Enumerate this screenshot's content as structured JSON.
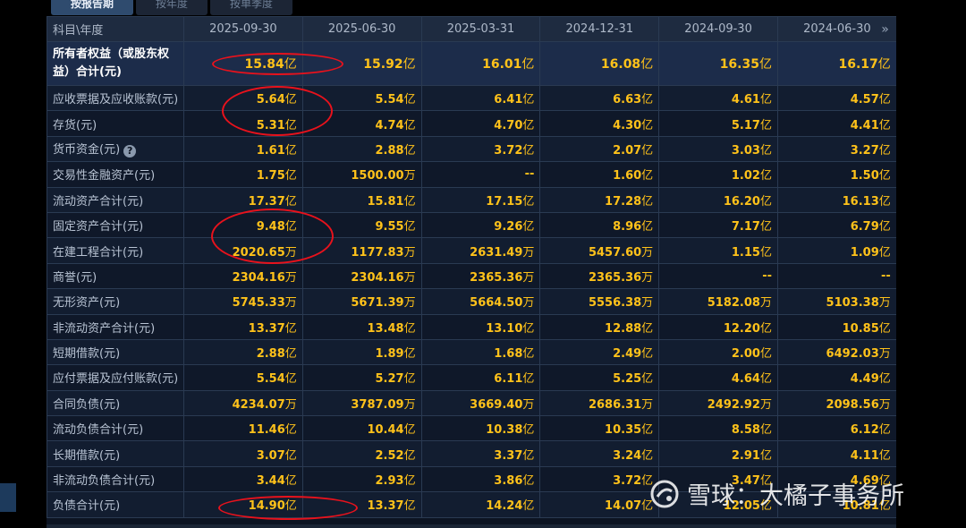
{
  "tabs": [
    "按报告期",
    "按年度",
    "按单季度"
  ],
  "header": {
    "first_col": "科目\\年度",
    "periods": [
      "2025-09-30",
      "2025-06-30",
      "2025-03-31",
      "2024-12-31",
      "2024-09-30",
      "2024-06-30"
    ],
    "more_icon": "double-chevron-right-icon"
  },
  "rows": [
    {
      "label": "所有者权益（或股东权益）合计(元)",
      "values": [
        [
          "15.84",
          "亿"
        ],
        [
          "15.92",
          "亿"
        ],
        [
          "16.01",
          "亿"
        ],
        [
          "16.08",
          "亿"
        ],
        [
          "16.35",
          "亿"
        ],
        [
          "16.17",
          "亿"
        ]
      ]
    },
    {
      "label": "应收票据及应收账款(元)",
      "values": [
        [
          "5.64",
          "亿"
        ],
        [
          "5.54",
          "亿"
        ],
        [
          "6.41",
          "亿"
        ],
        [
          "6.63",
          "亿"
        ],
        [
          "4.61",
          "亿"
        ],
        [
          "4.57",
          "亿"
        ]
      ]
    },
    {
      "label": "存货(元)",
      "values": [
        [
          "5.31",
          "亿"
        ],
        [
          "4.74",
          "亿"
        ],
        [
          "4.70",
          "亿"
        ],
        [
          "4.30",
          "亿"
        ],
        [
          "5.17",
          "亿"
        ],
        [
          "4.41",
          "亿"
        ]
      ]
    },
    {
      "label": "货币资金(元)",
      "values": [
        [
          "1.61",
          "亿"
        ],
        [
          "2.88",
          "亿"
        ],
        [
          "3.72",
          "亿"
        ],
        [
          "2.07",
          "亿"
        ],
        [
          "3.03",
          "亿"
        ],
        [
          "3.27",
          "亿"
        ]
      ]
    },
    {
      "label": "交易性金融资产(元)",
      "values": [
        [
          "1.75",
          "亿"
        ],
        [
          "1500.00",
          "万"
        ],
        [
          "--",
          ""
        ],
        [
          "1.60",
          "亿"
        ],
        [
          "1.02",
          "亿"
        ],
        [
          "1.50",
          "亿"
        ]
      ]
    },
    {
      "label": "流动资产合计(元)",
      "values": [
        [
          "17.37",
          "亿"
        ],
        [
          "15.81",
          "亿"
        ],
        [
          "17.15",
          "亿"
        ],
        [
          "17.28",
          "亿"
        ],
        [
          "16.20",
          "亿"
        ],
        [
          "16.13",
          "亿"
        ]
      ]
    },
    {
      "label": "固定资产合计(元)",
      "values": [
        [
          "9.48",
          "亿"
        ],
        [
          "9.55",
          "亿"
        ],
        [
          "9.26",
          "亿"
        ],
        [
          "8.96",
          "亿"
        ],
        [
          "7.17",
          "亿"
        ],
        [
          "6.79",
          "亿"
        ]
      ]
    },
    {
      "label": "在建工程合计(元)",
      "values": [
        [
          "2020.65",
          "万"
        ],
        [
          "1177.83",
          "万"
        ],
        [
          "2631.49",
          "万"
        ],
        [
          "5457.60",
          "万"
        ],
        [
          "1.15",
          "亿"
        ],
        [
          "1.09",
          "亿"
        ]
      ]
    },
    {
      "label": "商誉(元)",
      "values": [
        [
          "2304.16",
          "万"
        ],
        [
          "2304.16",
          "万"
        ],
        [
          "2365.36",
          "万"
        ],
        [
          "2365.36",
          "万"
        ],
        [
          "--",
          ""
        ],
        [
          "--",
          ""
        ]
      ]
    },
    {
      "label": "无形资产(元)",
      "values": [
        [
          "5745.33",
          "万"
        ],
        [
          "5671.39",
          "万"
        ],
        [
          "5664.50",
          "万"
        ],
        [
          "5556.38",
          "万"
        ],
        [
          "5182.08",
          "万"
        ],
        [
          "5103.38",
          "万"
        ]
      ]
    },
    {
      "label": "非流动资产合计(元)",
      "values": [
        [
          "13.37",
          "亿"
        ],
        [
          "13.48",
          "亿"
        ],
        [
          "13.10",
          "亿"
        ],
        [
          "12.88",
          "亿"
        ],
        [
          "12.20",
          "亿"
        ],
        [
          "10.85",
          "亿"
        ]
      ]
    },
    {
      "label": "短期借款(元)",
      "values": [
        [
          "2.88",
          "亿"
        ],
        [
          "1.89",
          "亿"
        ],
        [
          "1.68",
          "亿"
        ],
        [
          "2.49",
          "亿"
        ],
        [
          "2.00",
          "亿"
        ],
        [
          "6492.03",
          "万"
        ]
      ]
    },
    {
      "label": "应付票据及应付账款(元)",
      "values": [
        [
          "5.54",
          "亿"
        ],
        [
          "5.27",
          "亿"
        ],
        [
          "6.11",
          "亿"
        ],
        [
          "5.25",
          "亿"
        ],
        [
          "4.64",
          "亿"
        ],
        [
          "4.49",
          "亿"
        ]
      ]
    },
    {
      "label": "合同负债(元)",
      "values": [
        [
          "4234.07",
          "万"
        ],
        [
          "3787.09",
          "万"
        ],
        [
          "3669.40",
          "万"
        ],
        [
          "2686.31",
          "万"
        ],
        [
          "2492.92",
          "万"
        ],
        [
          "2098.56",
          "万"
        ]
      ]
    },
    {
      "label": "流动负债合计(元)",
      "values": [
        [
          "11.46",
          "亿"
        ],
        [
          "10.44",
          "亿"
        ],
        [
          "10.38",
          "亿"
        ],
        [
          "10.35",
          "亿"
        ],
        [
          "8.58",
          "亿"
        ],
        [
          "6.12",
          "亿"
        ]
      ]
    },
    {
      "label": "长期借款(元)",
      "values": [
        [
          "3.07",
          "亿"
        ],
        [
          "2.52",
          "亿"
        ],
        [
          "3.37",
          "亿"
        ],
        [
          "3.24",
          "亿"
        ],
        [
          "2.91",
          "亿"
        ],
        [
          "4.11",
          "亿"
        ]
      ]
    },
    {
      "label": "非流动负债合计(元)",
      "values": [
        [
          "3.44",
          "亿"
        ],
        [
          "2.93",
          "亿"
        ],
        [
          "3.86",
          "亿"
        ],
        [
          "3.72",
          "亿"
        ],
        [
          "3.47",
          "亿"
        ],
        [
          "4.69",
          "亿"
        ]
      ]
    },
    {
      "label": "负债合计(元)",
      "values": [
        [
          "14.90",
          "亿"
        ],
        [
          "13.37",
          "亿"
        ],
        [
          "14.24",
          "亿"
        ],
        [
          "14.07",
          "亿"
        ],
        [
          "12.05",
          "亿"
        ],
        [
          "10.81",
          "亿"
        ]
      ]
    }
  ],
  "help_icon_row": 3,
  "help_icon_glyph": "?",
  "watermark": "雪球：大橘子事务所",
  "colors": {
    "value": "#ffc21a",
    "annotation": "#e8121c",
    "header_bg": "#1e2b40",
    "highlight_bg": "#1c2c4a"
  }
}
